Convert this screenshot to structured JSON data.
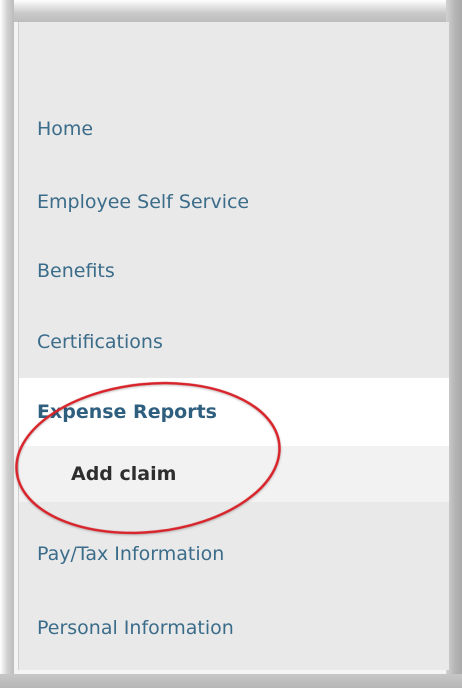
{
  "nav": {
    "items": [
      {
        "label": "Home"
      },
      {
        "label": "Employee Self Service"
      },
      {
        "label": "Benefits"
      },
      {
        "label": "Certifications"
      },
      {
        "label": "Expense Reports",
        "active": true
      },
      {
        "label": "Pay/Tax Information"
      },
      {
        "label": "Personal Information"
      }
    ],
    "subitems": [
      {
        "label": "Add claim"
      }
    ]
  },
  "annotation": {
    "color": "#d9232a",
    "shape": "ellipse"
  }
}
